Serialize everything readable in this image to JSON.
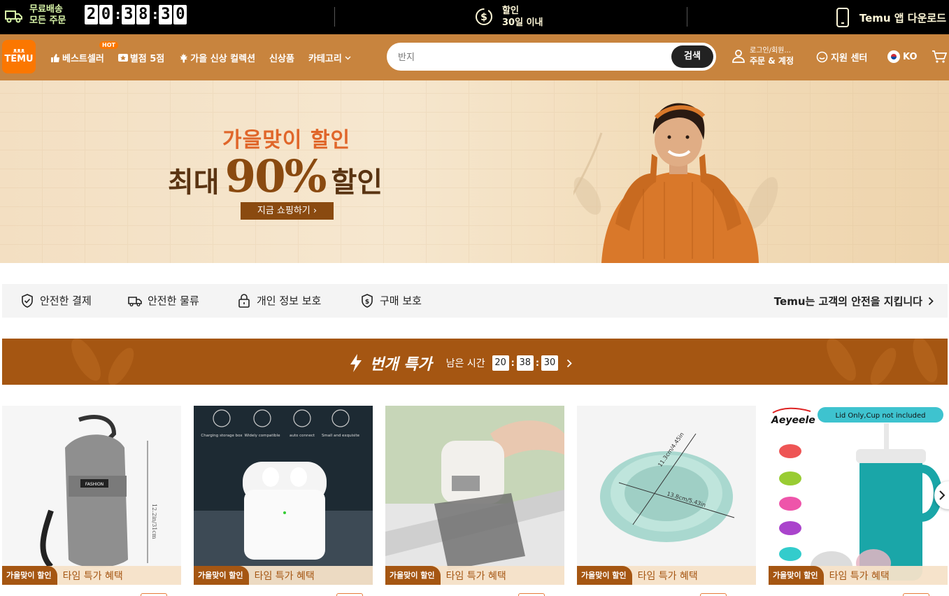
{
  "topbar": {
    "shipping_line1": "무료배송",
    "shipping_line2": "모든 주문",
    "countdown": [
      "2",
      "0",
      "3",
      "8",
      "3",
      "0"
    ],
    "sale_line1": "할인",
    "sale_line2": "30일 이내",
    "app_label": "Temu 앱 다운로드"
  },
  "nav": {
    "logo_top": "ᴥᴥᴥ",
    "logo_text": "TEMU",
    "items": [
      {
        "label": "베스트셀러",
        "badge": "HOT"
      },
      {
        "label": "별점 5점"
      },
      {
        "label": "가을 신상 컬렉션"
      },
      {
        "label": "신상품"
      },
      {
        "label": "카테고리"
      }
    ],
    "search_placeholder": "반지",
    "search_button": "검색",
    "account_line1": "로그인/회원...",
    "account_line2": "주문 & 계정",
    "support": "지원 센터",
    "language": "KO"
  },
  "banner": {
    "subtitle": "가을맞이 할인",
    "main_prefix": "최대",
    "main_value": "90%",
    "main_suffix": "할인",
    "cta": "지금 쇼핑하기 ›"
  },
  "trust": {
    "items": [
      "안전한 결제",
      "안전한 물류",
      "개인 정보 보호",
      "구매 보호"
    ],
    "right_text": "Temu는 고객의 안전을 지킵니다"
  },
  "flash": {
    "title": "번개 특가",
    "remaining_label": "남은 시간",
    "hours": "20",
    "minutes": "38",
    "seconds": "30"
  },
  "products": [
    {
      "tag_a": "가을맞이 할인",
      "tag_b": "타임 특가 혜택",
      "img_label": "FASHION",
      "dim_label": "12.2in/31cm"
    },
    {
      "tag_a": "가을맞이 할인",
      "tag_b": "타임 특가 혜택",
      "features": [
        "Charging storage box",
        "Widely compatible",
        "auto connect",
        "Small and exquisite"
      ]
    },
    {
      "tag_a": "가을맞이 할인",
      "tag_b": "타임 특가 혜택"
    },
    {
      "tag_a": "가을맞이 할인",
      "tag_b": "타임 특가 혜택",
      "dim1": "11.3cm/4.45in",
      "dim2": "13.8cm/5.43in"
    },
    {
      "tag_a": "가을맞이 할인",
      "tag_b": "타임 특가 혜택",
      "brand": "Aeyeele",
      "note": "Lid Only,Cup not included"
    }
  ],
  "colors": {
    "nav_bg": "#c8843e",
    "brand_orange": "#fb7701",
    "flash_bg": "#a55612",
    "shipping_green": "#d8f5a8"
  }
}
